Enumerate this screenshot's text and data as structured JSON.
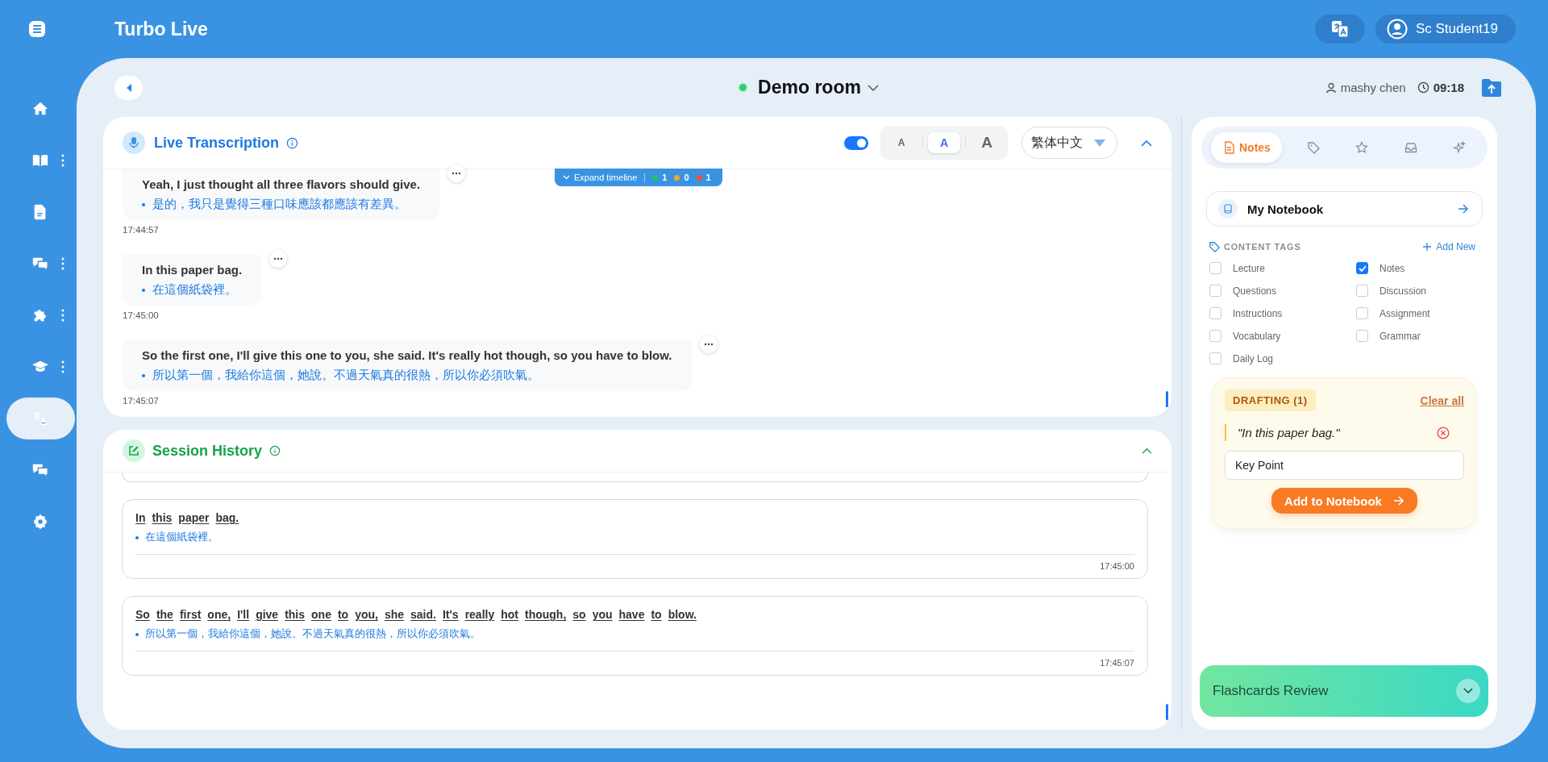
{
  "topbar": {
    "title": "Turbo Live",
    "user": "Sc Student19"
  },
  "sidebar": {
    "items": [
      {
        "kind": "home",
        "menu": false,
        "selected": false
      },
      {
        "kind": "book",
        "menu": true,
        "selected": false
      },
      {
        "kind": "document",
        "menu": false,
        "selected": false
      },
      {
        "kind": "chat",
        "menu": true,
        "selected": false
      },
      {
        "kind": "puzzle",
        "menu": true,
        "selected": false
      },
      {
        "kind": "graduation",
        "menu": true,
        "selected": false
      },
      {
        "kind": "translate",
        "menu": false,
        "selected": true
      },
      {
        "kind": "chat",
        "menu": false,
        "selected": false
      },
      {
        "kind": "settings",
        "menu": false,
        "selected": false
      }
    ]
  },
  "room": {
    "name": "Demo room",
    "live": true,
    "host": "mashy chen",
    "time": "09:18"
  },
  "transcription": {
    "title": "Live Transcription",
    "auto_scroll": true,
    "font_sizes": [
      {
        "label": "A",
        "kind": "small",
        "selected": false
      },
      {
        "label": "A",
        "kind": "medium",
        "selected": true
      },
      {
        "label": "A",
        "kind": "large",
        "selected": false
      }
    ],
    "language": "繁体中文",
    "timeline": {
      "label": "Expand timeline",
      "counts": [
        {
          "value": "1",
          "color": "#22c55e"
        },
        {
          "value": "0",
          "color": "#f5a623"
        },
        {
          "value": "1",
          "color": "#f0522d"
        }
      ]
    },
    "messages": [
      {
        "text": "Yeah, I just thought all three flavors should give.",
        "translation": "是的，我只是覺得三種口味應該都應該有差異。",
        "time": "17:44:57"
      },
      {
        "text": "In this paper bag.",
        "translation": "在這個紙袋裡。",
        "time": "17:45:00"
      },
      {
        "text": "So the first one, I'll give this one to you, she said. It's really hot though, so you have to blow.",
        "translation": "所以第一個，我給你這個，她說。不過天氣真的很熱，所以你必須吹氣。",
        "time": "17:45:07"
      }
    ]
  },
  "history": {
    "title": "Session History",
    "entries": [
      {
        "text": "In this paper bag.",
        "translation": "在這個紙袋裡。",
        "time": "17:45:00"
      },
      {
        "text": "So the first one, I'll give this one to you, she said. It's really hot though, so you have to blow.",
        "translation": "所以第一個，我給你這個，她說。不過天氣真的很熱，所以你必須吹氣。",
        "time": "17:45:07"
      }
    ]
  },
  "notes_panel": {
    "tabs": [
      {
        "kind": "notes",
        "label": "Notes",
        "selected": true
      },
      {
        "kind": "tags",
        "selected": false
      },
      {
        "kind": "favorites",
        "selected": false
      },
      {
        "kind": "inbox",
        "selected": false
      },
      {
        "kind": "ai",
        "selected": false
      }
    ],
    "notebook": "My Notebook",
    "tags_heading": "CONTENT TAGS",
    "add_new": "Add New",
    "tags": [
      {
        "label": "Lecture",
        "checked": false
      },
      {
        "label": "Notes",
        "checked": true
      },
      {
        "label": "Questions",
        "checked": false
      },
      {
        "label": "Discussion",
        "checked": false
      },
      {
        "label": "Instructions",
        "checked": false
      },
      {
        "label": "Assignment",
        "checked": false
      },
      {
        "label": "Vocabulary",
        "checked": false
      },
      {
        "label": "Grammar",
        "checked": false
      },
      {
        "label": "Daily Log",
        "checked": false
      }
    ],
    "drafting": {
      "label": "DRAFTING (1)",
      "clear": "Clear all",
      "quote": "\"In this paper bag.\"",
      "note_value": "Key Point",
      "add_button": "Add to Notebook"
    },
    "flashcards": "Flashcards Review"
  }
}
